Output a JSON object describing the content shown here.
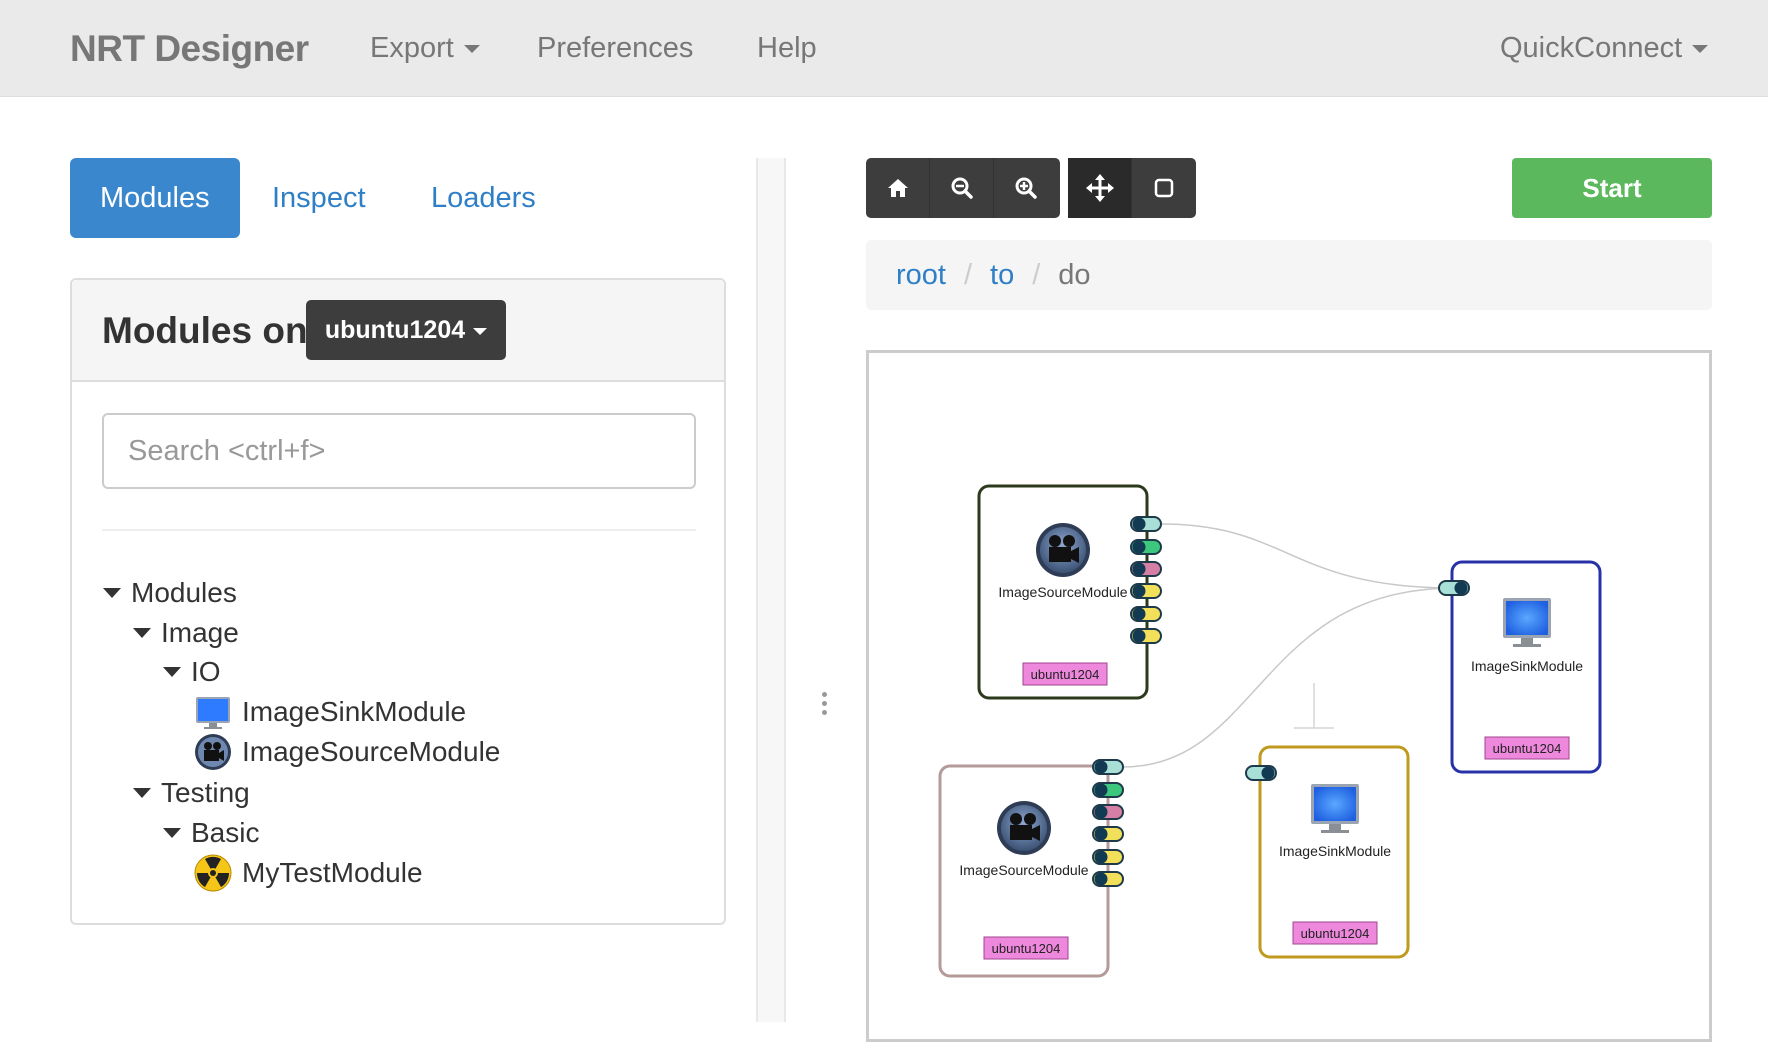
{
  "navbar": {
    "brand": "NRT Designer",
    "export_label": "Export",
    "preferences_label": "Preferences",
    "help_label": "Help",
    "quickconnect_label": "QuickConnect"
  },
  "tabs": [
    {
      "label": "Modules",
      "active": true
    },
    {
      "label": "Inspect",
      "active": false
    },
    {
      "label": "Loaders",
      "active": false
    }
  ],
  "modules_panel": {
    "title": "Modules on",
    "host": "ubuntu1204",
    "search_placeholder": "Search <ctrl+f>",
    "search_value": ""
  },
  "tree": {
    "root": "Modules",
    "image": "Image",
    "io": "IO",
    "image_sink": "ImageSinkModule",
    "image_source": "ImageSourceModule",
    "testing": "Testing",
    "basic": "Basic",
    "my_test": "MyTestModule"
  },
  "toolbar": {
    "icons": [
      "home-icon",
      "zoom-out-icon",
      "zoom-in-icon",
      "move-icon",
      "square-icon"
    ],
    "active": "move-icon",
    "start_label": "Start"
  },
  "breadcrumb": {
    "root": "root",
    "to": "to",
    "current": "do"
  },
  "graph": {
    "nodes": [
      {
        "id": "source-1",
        "label": "ImageSourceModule",
        "host": "ubuntu1204",
        "border_color": "#2b3a1a",
        "icon": "camera-icon"
      },
      {
        "id": "source-2",
        "label": "ImageSourceModule",
        "host": "ubuntu1204",
        "border_color": "#b59a9a",
        "icon": "camera-icon"
      },
      {
        "id": "sink-1",
        "label": "ImageSinkModule",
        "host": "ubuntu1204",
        "border_color": "#2832a8",
        "icon": "monitor-icon"
      },
      {
        "id": "sink-2",
        "label": "ImageSinkModule",
        "host": "ubuntu1204",
        "border_color": "#c09a1f",
        "icon": "monitor-icon"
      }
    ],
    "port_colors": [
      "#a8dfd6",
      "#3cc77c",
      "#d47fa3",
      "#f2e05a",
      "#f2e05a",
      "#f2e05a"
    ],
    "host_badge_color": "#ee88dd"
  },
  "colors": {
    "primary": "#3a87cd",
    "success": "#5cb85c",
    "dark_button": "#3d3d3d"
  }
}
